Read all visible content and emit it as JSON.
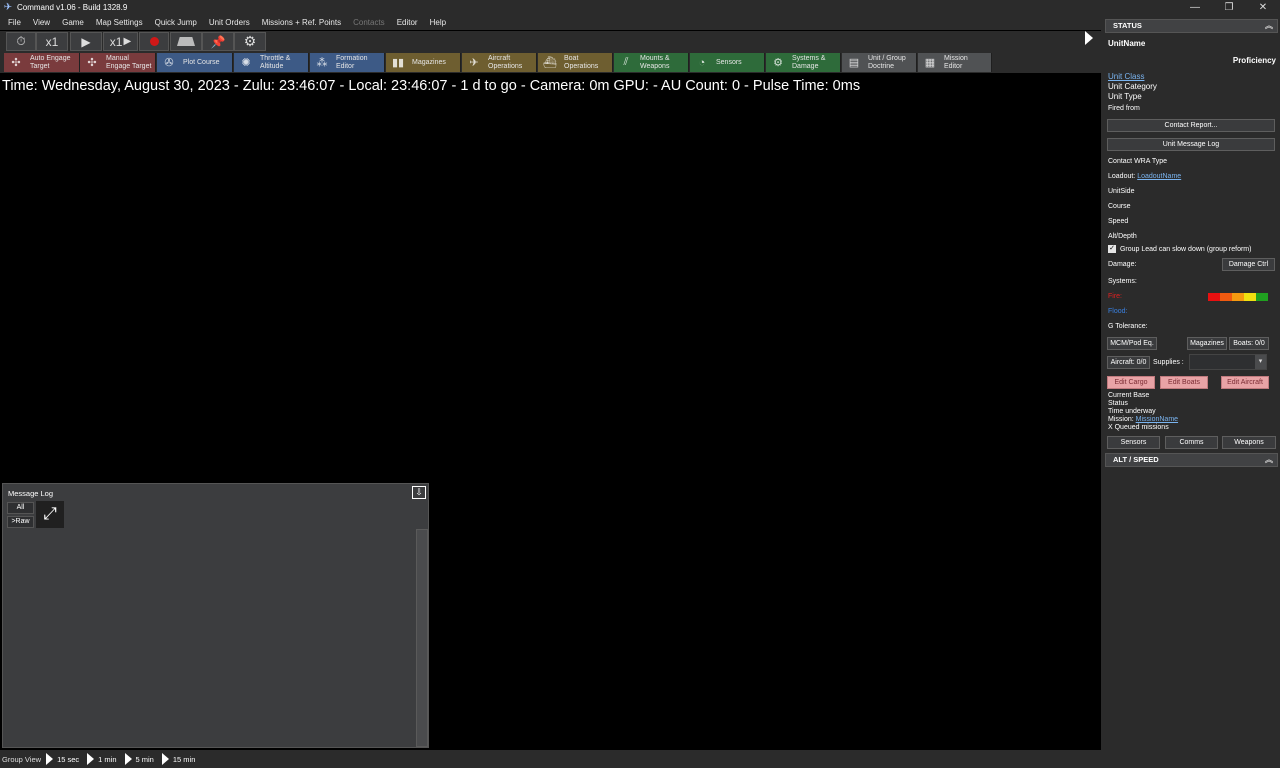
{
  "window": {
    "title": "Command v1.06 - Build 1328.9",
    "controls": [
      "—",
      "❐",
      "✕"
    ]
  },
  "menu": [
    "File",
    "View",
    "Game",
    "Map Settings",
    "Quick Jump",
    "Unit Orders",
    "Missions + Ref. Points",
    "Contacts",
    "Editor",
    "Help"
  ],
  "sim_controls": {
    "compression_left": "x1",
    "compression_right": "x1"
  },
  "toolbar": [
    {
      "label": "Auto Engage\nTarget",
      "color": "#7a3b3d",
      "icon": "target-icon"
    },
    {
      "label": "Manual\nEngage Target",
      "color": "#7a3b3d",
      "icon": "target-icon"
    },
    {
      "label": "Plot Course",
      "color": "#3d5a86",
      "icon": "course-icon"
    },
    {
      "label": "Throttle &\nAltitude",
      "color": "#3d5a86",
      "icon": "throttle-icon"
    },
    {
      "label": "Formation\nEditor",
      "color": "#3d5a86",
      "icon": "formation-icon"
    },
    {
      "label": "Magazines",
      "color": "#6e5e30",
      "icon": "magazines-icon"
    },
    {
      "label": "Aircraft\nOperations",
      "color": "#6e5e30",
      "icon": "aircraft-icon"
    },
    {
      "label": "Boat\nOperations",
      "color": "#6e5e30",
      "icon": "boat-icon"
    },
    {
      "label": "Mounts &\nWeapons",
      "color": "#2e6b3a",
      "icon": "mounts-icon"
    },
    {
      "label": "Sensors",
      "color": "#2e6b3a",
      "icon": "sensors-icon"
    },
    {
      "label": "Systems &\nDamage",
      "color": "#2e6b3a",
      "icon": "systems-icon"
    },
    {
      "label": "Unit / Group\nDoctrine",
      "color": "#505254",
      "icon": "doctrine-icon"
    },
    {
      "label": "Mission\nEditor",
      "color": "#505254",
      "icon": "mission-icon"
    }
  ],
  "status_line": "Time: Wednesday, August 30, 2023 - Zulu: 23:46:07 - Local: 23:46:07 - 1 d to go -  Camera: 0m  GPU:  - AU Count: 0 - Pulse Time: 0ms",
  "message_log": {
    "title": "Message Log",
    "all_label": "All",
    "raw_label": ">Raw"
  },
  "bottom_bar": {
    "label": "Group View",
    "steps": [
      "15 sec",
      "1 min",
      "5 min",
      "15 min"
    ]
  },
  "status_panel": {
    "header": "STATUS",
    "unit_name": "UnitName",
    "proficiency": "Proficiency",
    "unit_class": "Unit Class",
    "unit_category": "Unit Category",
    "unit_type": "Unit Type",
    "fired_from": "Fired from",
    "contact_report_button": "Contact Report...",
    "message_log_button": "Unit Message Log",
    "contact_wra": "Contact WRA Type",
    "loadout_label": "Loadout:",
    "loadout_value": "LoadoutName",
    "unit_side": "UnitSide",
    "course": "Course",
    "speed": "Speed",
    "alt_depth": "Alt/Depth",
    "group_lead_checkbox": "Group Lead can slow down (group reform)",
    "damage_label": "Damage:",
    "damage_ctrl_button": "Damage Ctrl",
    "systems_label": "Systems:",
    "systems_colors": [
      "#e81010",
      "#f05a10",
      "#f59a10",
      "#f0e010",
      "#20a020"
    ],
    "fire_label": "Fire:",
    "flood_label": "Flood:",
    "g_tolerance": "G Tolerance:",
    "mcm_button": "MCM/Pod Eq.",
    "magazines_button": "Magazines",
    "boats_button": "Boats: 0/0",
    "aircraft_button": "Aircraft: 0/0",
    "supplies_label": "Supplies :",
    "edit_cargo": "Edit Cargo",
    "edit_boats": "Edit Boats",
    "edit_aircraft": "Edit Aircraft",
    "current_base": "Current Base",
    "status": "Status",
    "time_underway": "Time underway",
    "mission_label": "Mission:",
    "mission_value": "MissionName",
    "queued_missions": "X Queued missions",
    "sensors_tab": "Sensors",
    "comms_tab": "Comms",
    "weapons_tab": "Weapons"
  },
  "alt_speed_header": "ALT / SPEED"
}
